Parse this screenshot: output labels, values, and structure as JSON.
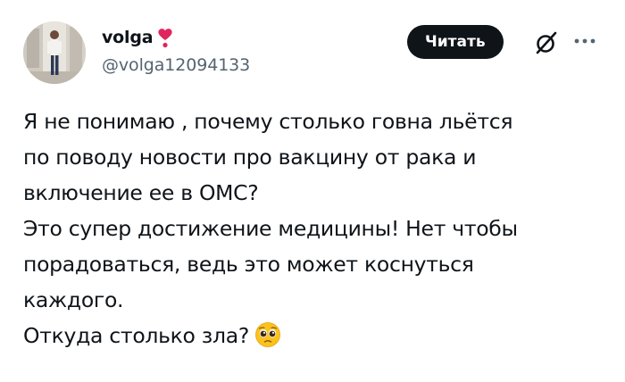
{
  "author": {
    "display_name": "volga",
    "handle": "@volga12094133",
    "name_badge_icon": "red-heart-exclamation-icon"
  },
  "actions": {
    "follow_label": "Читать",
    "grok_icon": "grok-icon",
    "more_icon": "more-icon"
  },
  "tweet": {
    "lines": [
      "Я не понимаю , почему столько говна льётся",
      "по поводу новости про вакцину от рака и",
      "включение ее в ОМС?",
      "Это супер достижение медицины! Нет чтобы",
      "порадоваться, ведь это может коснуться",
      "каждого.",
      "Откуда столько зла?"
    ],
    "emoji_icon": "pleading-face-emoji"
  },
  "colors": {
    "text_primary": "#0f1419",
    "text_secondary": "#536471",
    "button_bg": "#0f1419",
    "button_text": "#ffffff",
    "heart": "#e0245e"
  }
}
